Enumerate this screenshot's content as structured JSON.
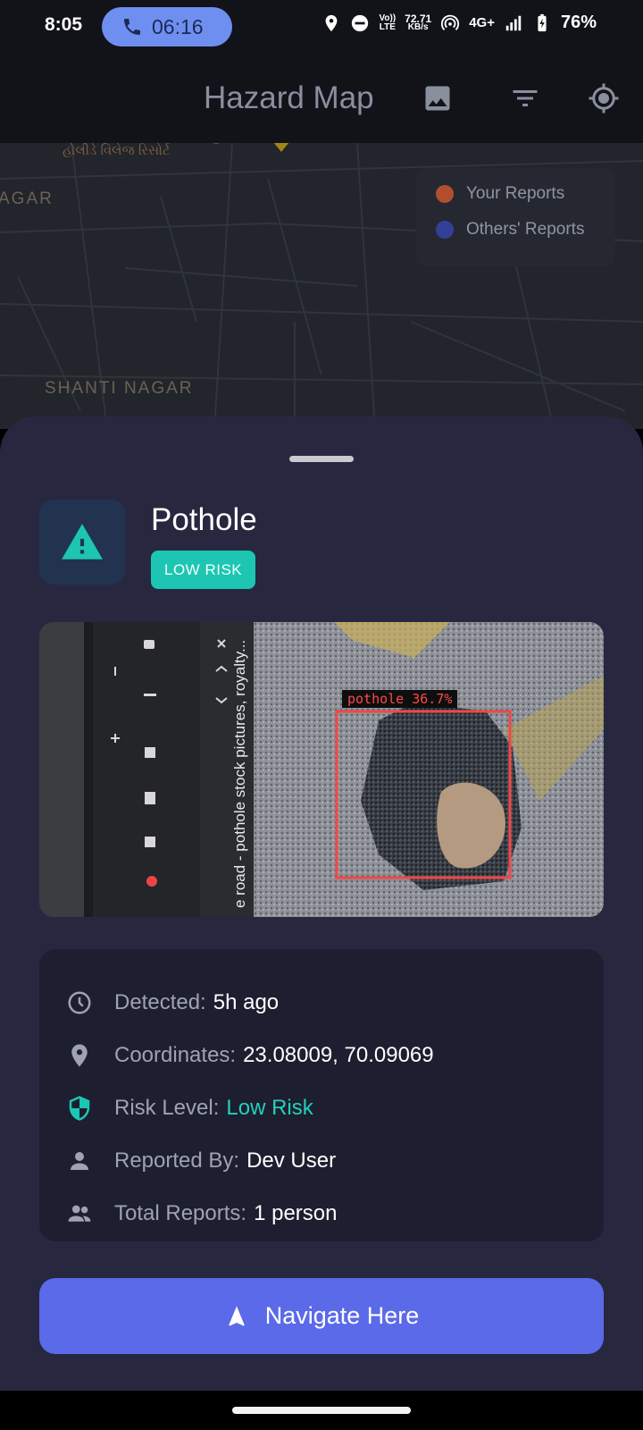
{
  "status_bar": {
    "time": "8:05",
    "call_time": "06:16",
    "network_top": "Vo))",
    "network_bottom": "LTE",
    "speed_value": "72.71",
    "speed_unit": "KB/s",
    "signal_type": "4G+",
    "battery": "76%"
  },
  "app_bar": {
    "title": "Hazard Map",
    "icons": [
      "image-icon",
      "filter-icon",
      "my-location-icon"
    ]
  },
  "map": {
    "labels": [
      "AGAR",
      "SHANTI NAGAR"
    ],
    "place_label": "હોલીડે વિલેજ રિસોર્ટ",
    "legend": [
      {
        "label": "Your Reports",
        "color": "#b24d2e"
      },
      {
        "label": "Others' Reports",
        "color": "#33409a"
      }
    ]
  },
  "sheet": {
    "hazard_type": "Pothole",
    "risk_badge": "LOW RISK",
    "photo": {
      "detection_label": "pothole 36.7%",
      "screen_text": "e road - pothole stock pictures, royalty..."
    },
    "details": [
      {
        "icon": "clock-icon",
        "label": "Detected:",
        "value": "5h ago"
      },
      {
        "icon": "location-pin-icon",
        "label": "Coordinates:",
        "value": "23.08009, 70.09069"
      },
      {
        "icon": "shield-icon",
        "label": "Risk Level:",
        "value": "Low Risk"
      },
      {
        "icon": "person-icon",
        "label": "Reported By:",
        "value": "Dev User"
      },
      {
        "icon": "people-icon",
        "label": "Total Reports:",
        "value": "1 person"
      }
    ],
    "navigate_label": "Navigate Here"
  },
  "colors": {
    "accent_teal": "#1dc6b2",
    "button_blue": "#5b6ae8",
    "sheet_bg": "#272840"
  }
}
